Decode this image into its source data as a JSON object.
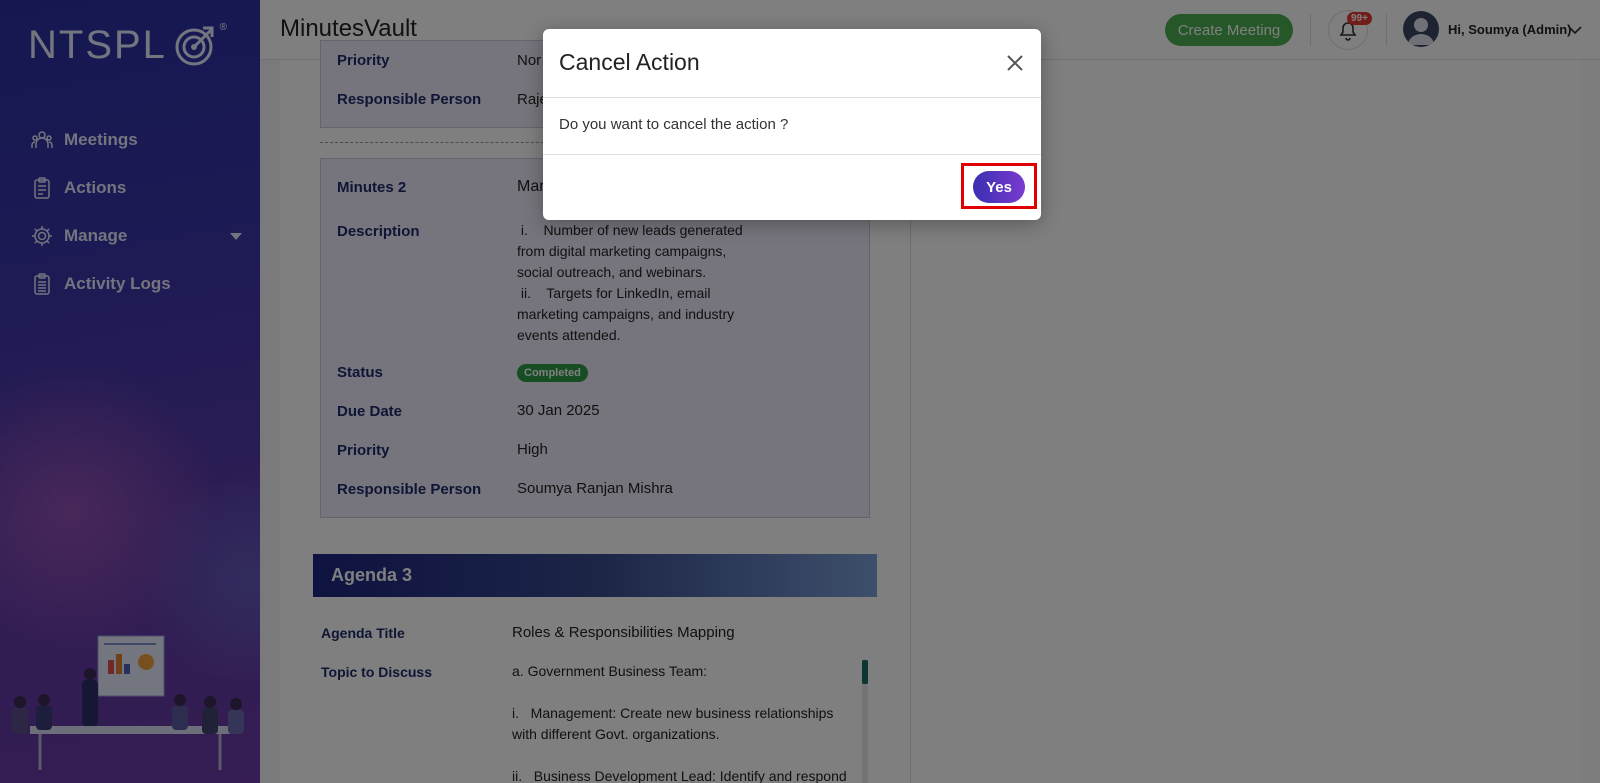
{
  "app": {
    "logo_text": "NTSPL",
    "title": "MinutesVault"
  },
  "sidebar": {
    "items": [
      {
        "label": "Meetings",
        "icon": "meetings-icon"
      },
      {
        "label": "Actions",
        "icon": "clipboard-icon"
      },
      {
        "label": "Manage",
        "icon": "gear-icon"
      },
      {
        "label": "Activity Logs",
        "icon": "logs-icon"
      }
    ]
  },
  "header": {
    "create_label": "Create Meeting",
    "notification_badge": "99+",
    "user_greeting": "Hi, Soumya (Admin)"
  },
  "minutes_top": {
    "priority_label": "Priority",
    "priority_value": "Nor",
    "responsible_label": "Responsible Person",
    "responsible_value": "Raje"
  },
  "minutes2": {
    "title_label": "Minutes 2",
    "title_value": "Mar",
    "description_label": "Description",
    "description_lines": [
      " i.    Number of new leads generated",
      "from digital marketing campaigns,",
      "social outreach, and webinars.",
      " ii.    Targets for LinkedIn, email",
      "marketing campaigns, and industry",
      "events attended."
    ],
    "status_label": "Status",
    "status_value": "Completed",
    "due_label": "Due Date",
    "due_value": "30 Jan 2025",
    "priority_label": "Priority",
    "priority_value": "High",
    "responsible_label": "Responsible Person",
    "responsible_value": "Soumya Ranjan Mishra"
  },
  "agenda3": {
    "heading": "Agenda 3",
    "title_label": "Agenda Title",
    "title_value": "Roles & Responsibilities Mapping",
    "topic_label": "Topic to Discuss",
    "topic_lines": [
      "a. Government Business Team:",
      "",
      "i.   Management: Create new business relationships",
      "with different Govt. organizations.",
      "",
      "ii.   Business Development Lead: Identify and respond"
    ]
  },
  "modal": {
    "title": "Cancel Action",
    "message": "Do you want to cancel the action ?",
    "confirm_label": "Yes"
  }
}
